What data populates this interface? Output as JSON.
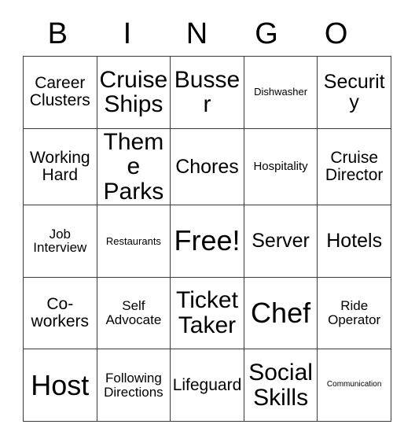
{
  "card": {
    "header_letters": [
      "B",
      "I",
      "N",
      "G",
      "O"
    ],
    "rows": [
      [
        {
          "text": "Career Clusters",
          "size": "md"
        },
        {
          "text": "Cruise Ships",
          "size": "xl"
        },
        {
          "text": "Busser",
          "size": "xl"
        },
        {
          "text": "Dishwasher",
          "size": "xxs"
        },
        {
          "text": "Security",
          "size": "lg"
        }
      ],
      [
        {
          "text": "Working Hard",
          "size": "md"
        },
        {
          "text": "Theme Parks",
          "size": "xl"
        },
        {
          "text": "Chores",
          "size": "lg"
        },
        {
          "text": "Hospitality",
          "size": "xs"
        },
        {
          "text": "Cruise Director",
          "size": "md"
        }
      ],
      [
        {
          "text": "Job Interview",
          "size": "sm"
        },
        {
          "text": "Restaurants",
          "size": "xxs"
        },
        {
          "text": "Free!",
          "size": "xxl"
        },
        {
          "text": "Server",
          "size": "lg"
        },
        {
          "text": "Hotels",
          "size": "lg"
        }
      ],
      [
        {
          "text": "Co-workers",
          "size": "md"
        },
        {
          "text": "Self Advocate",
          "size": "sm"
        },
        {
          "text": "Ticket Taker",
          "size": "xl"
        },
        {
          "text": "Chef",
          "size": "xxl"
        },
        {
          "text": "Ride Operator",
          "size": "sm"
        }
      ],
      [
        {
          "text": "Host",
          "size": "xxl"
        },
        {
          "text": "Following Directions",
          "size": "sm"
        },
        {
          "text": "Lifeguard",
          "size": "md"
        },
        {
          "text": "Social Skills",
          "size": "xl"
        },
        {
          "text": "Communication",
          "size": "tiny"
        }
      ]
    ]
  }
}
